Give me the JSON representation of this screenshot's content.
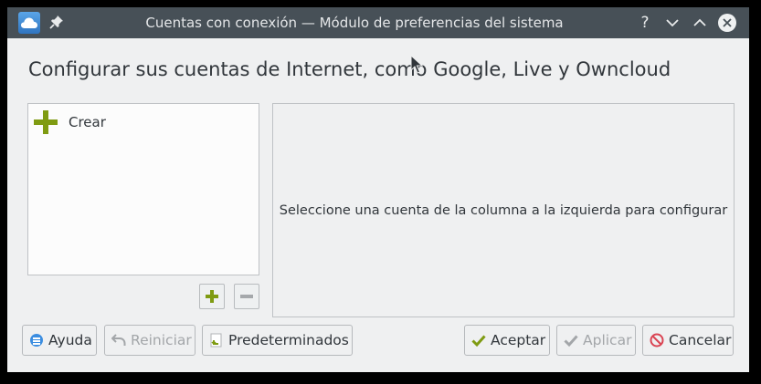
{
  "window": {
    "title": "Cuentas con conexión — Módulo de preferencias del sistema"
  },
  "titlebar": {
    "help_icon": "help-icon",
    "minimize_icon": "chevron-down-icon",
    "maximize_icon": "chevron-up-icon",
    "close_icon": "close-icon"
  },
  "heading": "Configurar sus cuentas de Internet, como Google, Live y Owncloud",
  "accounts": {
    "items": [
      {
        "label": "Crear",
        "icon": "plus-icon"
      }
    ]
  },
  "detail": {
    "message": "Seleccione una cuenta de la columna a la izquierda para configurar"
  },
  "buttons": {
    "help": "Ayuda",
    "reset": "Reiniciar",
    "defaults": "Predeterminados",
    "ok": "Aceptar",
    "apply": "Aplicar",
    "cancel": "Cancelar"
  },
  "colors": {
    "titlebar": "#475057",
    "accent_green": "#7f9b12",
    "cancel_red": "#da4453",
    "help_blue": "#3b8de0"
  }
}
